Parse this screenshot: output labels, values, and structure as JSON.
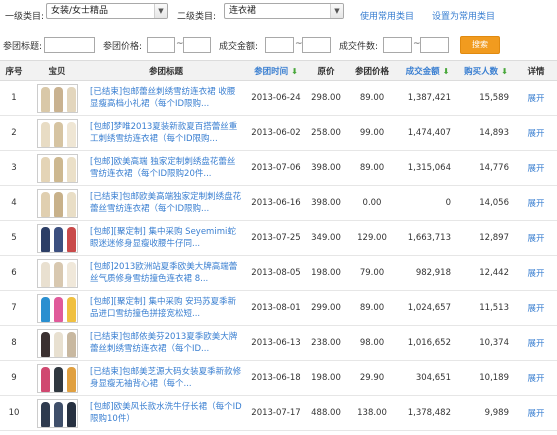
{
  "filters": {
    "cat1_label": "一级类目:",
    "cat1_value": "女装/女士精品",
    "cat2_label": "二级类目:",
    "cat2_value": "连衣裙",
    "use_common": "使用常用类目",
    "set_common": "设置为常用类目",
    "title_label": "参团标题:",
    "price_label": "参团价格:",
    "amount_label": "成交金额:",
    "count_label": "成交件数:",
    "tilde": "~",
    "search_btn": "搜索"
  },
  "table": {
    "headers": {
      "no": "序号",
      "item": "宝贝",
      "title": "参团标题",
      "time": "参团时间",
      "orig_price": "原价",
      "group_price": "参团价格",
      "amount": "成交金额",
      "buyers": "购买人数",
      "detail": "详情"
    },
    "detail_link": "展开",
    "rows": [
      {
        "no": "1",
        "title": "[已结束]包邮蕾丝刺绣雪纺连衣裙 收腰显瘦高档小礼裙（每个ID限购...",
        "time": "2013-06-24",
        "orig": "298.00",
        "price": "89.00",
        "amount": "1,387,421",
        "buyers": "15,589",
        "thumb": [
          "#d9c8a8",
          "#c9b290",
          "#e3d6bd"
        ]
      },
      {
        "no": "2",
        "title": "[包邮]梦唯2013夏装新款夏百搭蕾丝重工刺绣雪纺连衣裙（每个ID限购...",
        "time": "2013-06-02",
        "orig": "258.00",
        "price": "99.00",
        "amount": "1,474,407",
        "buyers": "14,893",
        "thumb": [
          "#e8dcc4",
          "#d6c4a2",
          "#efe6d4"
        ]
      },
      {
        "no": "3",
        "title": "[包邮]欧美高端 独家定制刺绣盘花蕾丝雪纺连衣裙（每个ID限购20件...",
        "time": "2013-07-06",
        "orig": "398.00",
        "price": "89.00",
        "amount": "1,315,064",
        "buyers": "14,776",
        "thumb": [
          "#e4d4b6",
          "#cdb890",
          "#ebe0c8"
        ]
      },
      {
        "no": "4",
        "title": "[已结束]包邮欧美高端独家定制刺绣盘花蕾丝雪纺连衣裙（每个ID限购...",
        "time": "2013-06-16",
        "orig": "398.00",
        "price": "0.00",
        "amount": "0",
        "buyers": "14,056",
        "thumb": [
          "#e0cfb0",
          "#c8b18a",
          "#e9dec6"
        ]
      },
      {
        "no": "5",
        "title": "[包邮][聚定制] 集中采购 Seyemimi蛇眼迷迷修身显瘦收腰牛仔同...",
        "time": "2013-07-25",
        "orig": "349.00",
        "price": "129.00",
        "amount": "1,663,713",
        "buyers": "12,897",
        "thumb": [
          "#2c3e66",
          "#3c5080",
          "#c94a4a"
        ]
      },
      {
        "no": "6",
        "title": "[包邮]2013欧洲站夏季欧美大牌高端蕾丝气质修身雪纺撞色连衣裙 8...",
        "time": "2013-08-05",
        "orig": "198.00",
        "price": "79.00",
        "amount": "982,918",
        "buyers": "12,442",
        "thumb": [
          "#e9e0d0",
          "#d8c8b0",
          "#f0e8da"
        ]
      },
      {
        "no": "7",
        "title": "[包邮][聚定制] 集中采购 安玛苏夏季新品进口雪纺撞色拼接宽松短...",
        "time": "2013-08-01",
        "orig": "299.00",
        "price": "89.00",
        "amount": "1,024,657",
        "buyers": "11,513",
        "thumb": [
          "#2a8fd0",
          "#e05a9a",
          "#f0c040"
        ]
      },
      {
        "no": "8",
        "title": "[已结束]包邮依美芬2013夏季欧美大牌蕾丝刺绣雪纺连衣裙（每个ID...",
        "time": "2013-06-13",
        "orig": "238.00",
        "price": "98.00",
        "amount": "1,016,652",
        "buyers": "10,374",
        "thumb": [
          "#3a3030",
          "#e8e0d0",
          "#c8b8a0"
        ]
      },
      {
        "no": "9",
        "title": "[已结束]包邮美芝源大码女装夏季新款修身显瘦无袖背心裙（每个...",
        "time": "2013-06-18",
        "orig": "198.00",
        "price": "29.90",
        "amount": "304,651",
        "buyers": "10,189",
        "thumb": [
          "#d04870",
          "#303840",
          "#e0a040"
        ]
      },
      {
        "no": "10",
        "title": "[包邮]欧美风长款水洗牛仔长裙（每个ID限购10件）",
        "time": "2013-07-17",
        "orig": "488.00",
        "price": "138.00",
        "amount": "1,378,482",
        "buyers": "9,989",
        "thumb": [
          "#2e3a4e",
          "#3f4f6a",
          "#263040"
        ]
      }
    ]
  }
}
